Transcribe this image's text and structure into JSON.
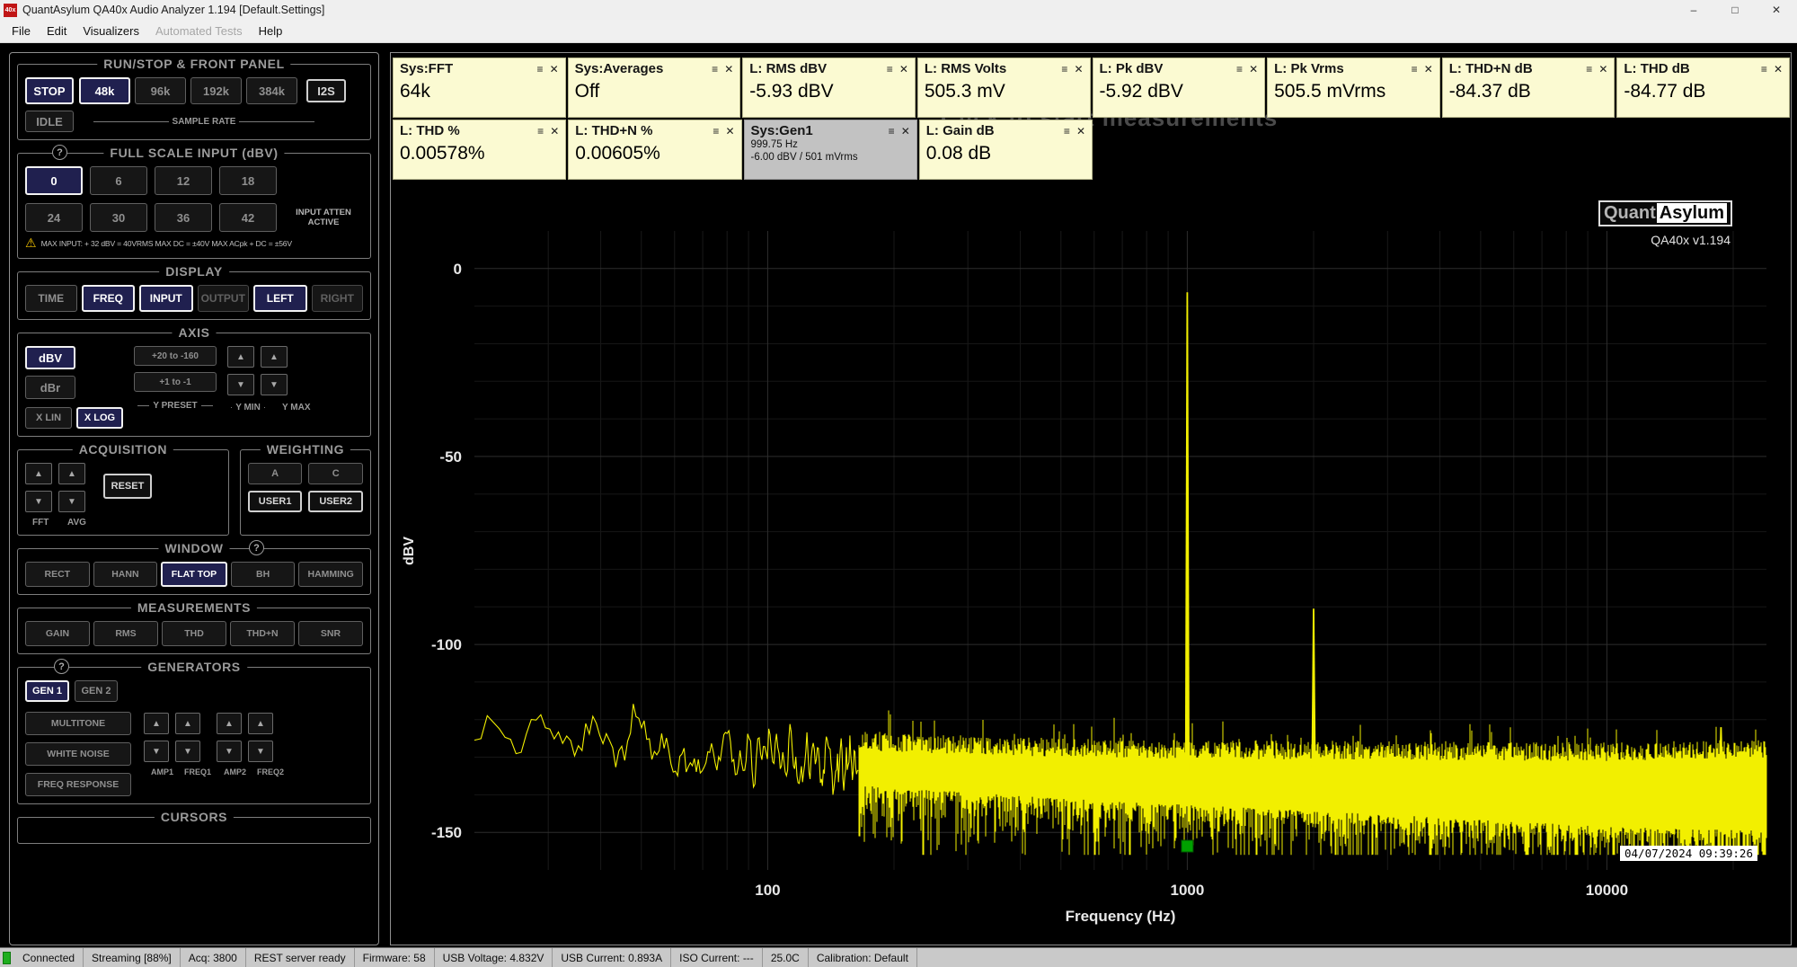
{
  "icons": {
    "up": "▲",
    "down": "▼",
    "menu": "≡",
    "close": "✕",
    "warning": "⚠",
    "help": "?",
    "minimize": "–",
    "maximize": "□",
    "window_close": "✕"
  },
  "window": {
    "icon_label": "40x",
    "title": "QuantAsylum QA40x Audio Analyzer 1.194 [Default.Settings]"
  },
  "menu": {
    "items": [
      {
        "label": "File",
        "enabled": true
      },
      {
        "label": "Edit",
        "enabled": true
      },
      {
        "label": "Visualizers",
        "enabled": true
      },
      {
        "label": "Automated Tests",
        "enabled": false
      },
      {
        "label": "Help",
        "enabled": true
      }
    ]
  },
  "sidebar": {
    "run_stop": {
      "title": "RUN/STOP & FRONT PANEL",
      "stop_label": "STOP",
      "idle_label": "IDLE",
      "i2s_label": "I2S",
      "sample_rate_label": "SAMPLE RATE",
      "rates": [
        {
          "label": "48k",
          "state": "on"
        },
        {
          "label": "96k",
          "state": "off"
        },
        {
          "label": "192k",
          "state": "off"
        },
        {
          "label": "384k",
          "state": "off"
        }
      ]
    },
    "full_scale": {
      "title": "FULL SCALE INPUT (dBV)",
      "row1": [
        {
          "label": "0",
          "state": "on"
        },
        {
          "label": "6",
          "state": "off"
        },
        {
          "label": "12",
          "state": "off"
        },
        {
          "label": "18",
          "state": "off"
        }
      ],
      "row2": [
        {
          "label": "24",
          "state": "off"
        },
        {
          "label": "30",
          "state": "off"
        },
        {
          "label": "36",
          "state": "off"
        },
        {
          "label": "42",
          "state": "off"
        }
      ],
      "atten_label": "INPUT ATTEN ACTIVE",
      "warning": "MAX INPUT: + 32 dBV = 40VRMS    MAX DC = ±40V    MAX ACpk + DC = ±56V"
    },
    "display": {
      "title": "DISPLAY",
      "buttons": [
        {
          "label": "TIME",
          "state": "off"
        },
        {
          "label": "FREQ",
          "state": "on"
        },
        {
          "label": "INPUT",
          "state": "on"
        },
        {
          "label": "OUTPUT",
          "state": "dim"
        },
        {
          "label": "LEFT",
          "state": "on"
        },
        {
          "label": "RIGHT",
          "state": "dim"
        }
      ]
    },
    "axis": {
      "title": "AXIS",
      "db_buttons": [
        {
          "label": "dBV",
          "state": "on"
        },
        {
          "label": "dBr",
          "state": "off"
        }
      ],
      "x_buttons": [
        {
          "label": "X LIN",
          "state": "off"
        },
        {
          "label": "X LOG",
          "state": "on"
        }
      ],
      "preset_buttons": [
        {
          "label": "+20 to -160",
          "state": "off"
        },
        {
          "label": "+1 to -1",
          "state": "off"
        }
      ],
      "preset_label": "Y PRESET",
      "ymin_label": "Y MIN",
      "ymax_label": "Y MAX"
    },
    "acquisition": {
      "title": "ACQUISITION",
      "fft_label": "FFT",
      "avg_label": "AVG",
      "reset_label": "RESET"
    },
    "weighting": {
      "title": "WEIGHTING",
      "buttons": [
        {
          "label": "A",
          "state": "off"
        },
        {
          "label": "C",
          "state": "off"
        },
        {
          "label": "USER1",
          "state": "frame"
        },
        {
          "label": "USER2",
          "state": "frame"
        }
      ]
    },
    "window_fn": {
      "title": "WINDOW",
      "buttons": [
        {
          "label": "RECT",
          "state": "off"
        },
        {
          "label": "HANN",
          "state": "off"
        },
        {
          "label": "FLAT TOP",
          "state": "on"
        },
        {
          "label": "BH",
          "state": "off"
        },
        {
          "label": "HAMMING",
          "state": "off"
        }
      ]
    },
    "measurements": {
      "title": "MEASUREMENTS",
      "buttons": [
        {
          "label": "GAIN",
          "state": "off"
        },
        {
          "label": "RMS",
          "state": "off"
        },
        {
          "label": "THD",
          "state": "off"
        },
        {
          "label": "THD+N",
          "state": "off"
        },
        {
          "label": "SNR",
          "state": "off"
        }
      ]
    },
    "generators": {
      "title": "GENERATORS",
      "gen_buttons": [
        {
          "label": "GEN 1",
          "state": "on"
        },
        {
          "label": "GEN 2",
          "state": "off"
        }
      ],
      "mode_buttons": [
        {
          "label": "MULTITONE",
          "state": "off"
        },
        {
          "label": "WHITE NOISE",
          "state": "off"
        },
        {
          "label": "FREQ RESPONSE",
          "state": "off"
        }
      ],
      "amp1_label": "AMP1",
      "freq1_label": "FREQ1",
      "amp2_label": "AMP2",
      "freq2_label": "FREQ2"
    },
    "cursors": {
      "title": "CURSORS"
    }
  },
  "tiles": {
    "row1": [
      {
        "title": "Sys:FFT",
        "value": "64k"
      },
      {
        "title": "Sys:Averages",
        "value": "Off"
      },
      {
        "title": "L: RMS dBV",
        "value": "-5.93 dBV"
      },
      {
        "title": "L: RMS Volts",
        "value": "505.3 mV"
      },
      {
        "title": "L: Pk dBV",
        "value": "-5.92 dBV"
      },
      {
        "title": "L: Pk Vrms",
        "value": "505.5 mVrms"
      },
      {
        "title": "L: THD+N dB",
        "value": "-84.37 dB"
      },
      {
        "title": "L: THD dB",
        "value": "-84.77 dB"
      }
    ],
    "row2": [
      {
        "title": "L: THD %",
        "value": "0.00578%"
      },
      {
        "title": "L: THD+N %",
        "value": "0.00605%"
      },
      {
        "title": "Sys:Gen1",
        "gray": true,
        "lines": [
          "999.75 Hz",
          "-6.00 dBV  / 501 mVrms"
        ]
      },
      {
        "title": "L: Gain dB",
        "value": "0.08 dB"
      }
    ]
  },
  "watermark": "Click to start measurements",
  "plot": {
    "logo_part1": "Quant",
    "logo_part2": "Asylum",
    "version": "QA40x v1.194",
    "timestamp": "04/07/2024 09:39:26"
  },
  "chart_data": {
    "type": "line",
    "title": "",
    "xlabel": "Frequency (Hz)",
    "ylabel": "dBV",
    "x_scale": "log",
    "xlim": [
      20,
      24000
    ],
    "ylim": [
      -160,
      10
    ],
    "x_ticks": [
      100,
      1000,
      10000
    ],
    "y_ticks": [
      0,
      -50,
      -100,
      -150
    ],
    "grid": true,
    "trace_color": "#f2ef00",
    "grid_color": "#2e2e2e",
    "fft_bin_hz": 0.7324,
    "noise_floor": [
      [
        20,
        -124
      ],
      [
        50,
        -127
      ],
      [
        100,
        -130
      ],
      [
        200,
        -132
      ],
      [
        500,
        -134
      ],
      [
        1000,
        -135
      ],
      [
        5000,
        -137
      ],
      [
        10000,
        -138
      ],
      [
        24000,
        -138
      ]
    ],
    "peaks": [
      {
        "freq_hz": 999.75,
        "level_dbv": -6.3
      },
      {
        "freq_hz": 2000,
        "level_dbv": -90.5
      },
      {
        "freq_hz": 3000,
        "level_dbv": -127
      },
      {
        "freq_hz": 18700,
        "level_dbv": -122
      }
    ],
    "marker": {
      "freq_hz": 1000,
      "color": "#00a000"
    }
  },
  "status_bar": {
    "items": [
      "Connected",
      "Streaming [88%]",
      "Acq: 3800",
      "REST server ready",
      "Firmware: 58",
      "USB Voltage: 4.832V",
      "USB Current: 0.893A",
      "ISO Current: ---",
      "25.0C",
      "Calibration: Default"
    ]
  }
}
